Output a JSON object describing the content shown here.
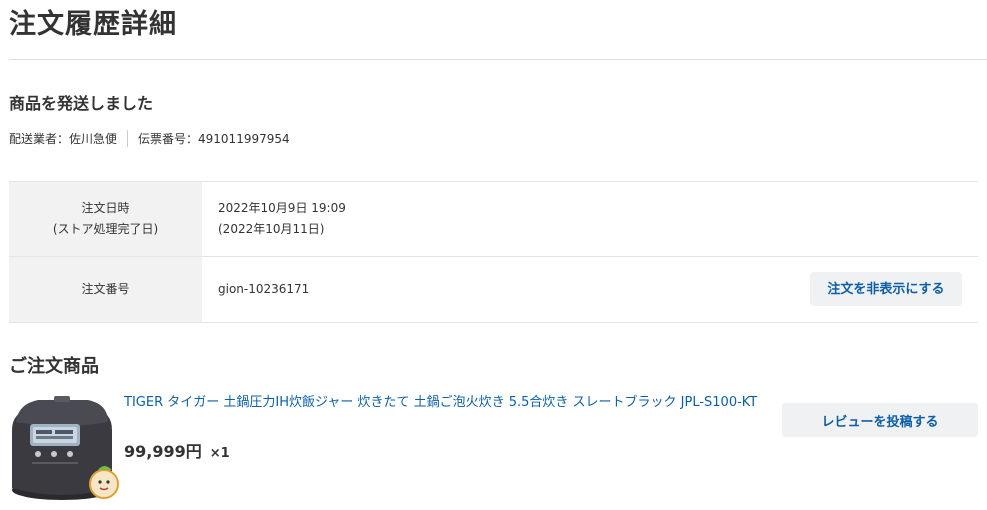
{
  "page": {
    "title": "注文履歴詳細"
  },
  "shipping": {
    "heading": "商品を発送しました",
    "carrier_label": "配送業者：佐川急便",
    "tracking_label": "伝票番号：491011997954"
  },
  "order": {
    "date_label_line1": "注文日時",
    "date_label_line2": "(ストア処理完了日)",
    "date_value": "2022年10月9日 19:09",
    "completed_value": "(2022年10月11日)",
    "number_label": "注文番号",
    "number_value": "gion-10236171",
    "hide_button": "注文を非表示にする"
  },
  "items": {
    "heading": "ご注文商品",
    "list": [
      {
        "name": "TIGER タイガー 土鍋圧力IH炊飯ジャー 炊きたて 土鍋ご泡火炊き 5.5合炊き スレートブラック JPL-S100-KT",
        "price": "99,999円",
        "quantity": "×1",
        "review_button": "レビューを投稿する",
        "image_icon": "rice-cooker-image"
      }
    ]
  },
  "colors": {
    "link": "#0d5ea6",
    "header_cell": "#f2f2f2",
    "button_bg": "#f0f1f3"
  }
}
